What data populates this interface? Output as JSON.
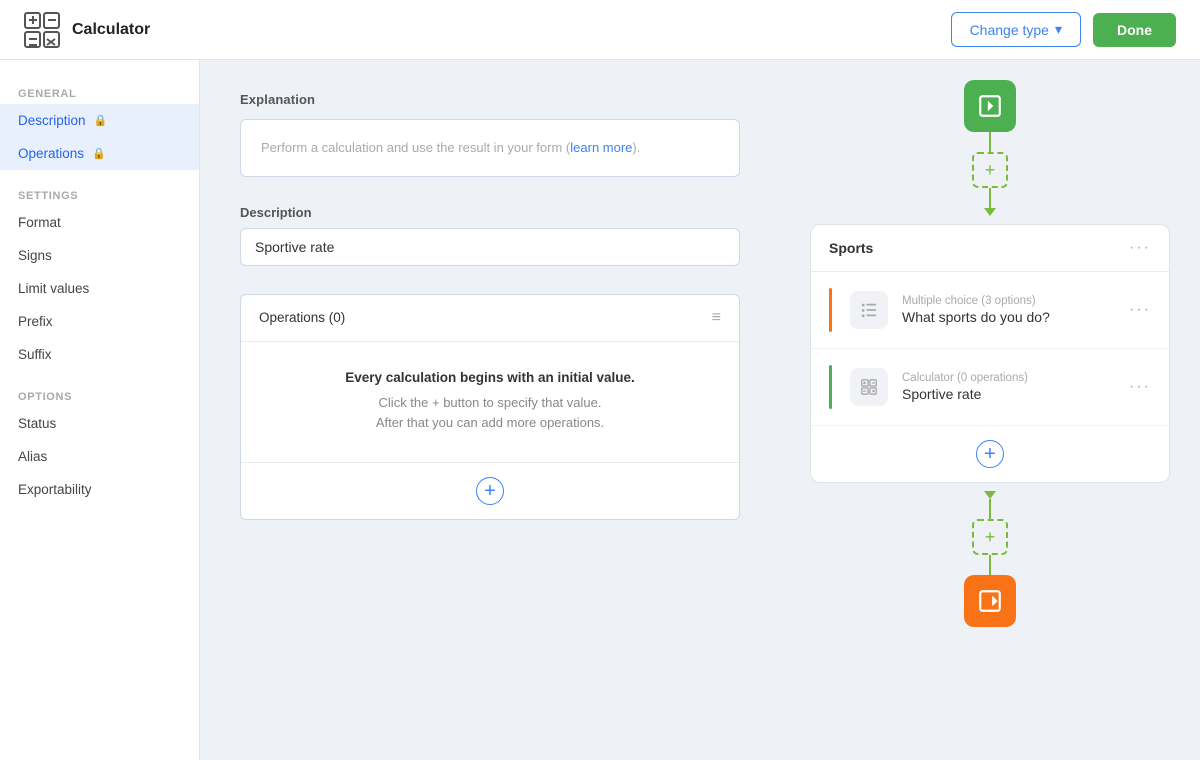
{
  "header": {
    "title": "Calculator",
    "change_type_label": "Change type",
    "done_label": "Done"
  },
  "sidebar": {
    "general_label": "General",
    "settings_label": "Settings",
    "options_label": "Options",
    "items_general": [
      {
        "label": "Description",
        "locked": true,
        "active": true,
        "id": "description"
      },
      {
        "label": "Operations",
        "locked": true,
        "active": true,
        "id": "operations"
      }
    ],
    "items_settings": [
      {
        "label": "Format",
        "locked": false,
        "active": false,
        "id": "format"
      },
      {
        "label": "Signs",
        "locked": false,
        "active": false,
        "id": "signs"
      },
      {
        "label": "Limit values",
        "locked": false,
        "active": false,
        "id": "limit-values"
      },
      {
        "label": "Prefix",
        "locked": false,
        "active": false,
        "id": "prefix"
      },
      {
        "label": "Suffix",
        "locked": false,
        "active": false,
        "id": "suffix"
      }
    ],
    "items_options": [
      {
        "label": "Status",
        "locked": false,
        "active": false,
        "id": "status"
      },
      {
        "label": "Alias",
        "locked": false,
        "active": false,
        "id": "alias"
      },
      {
        "label": "Exportability",
        "locked": false,
        "active": false,
        "id": "exportability"
      }
    ]
  },
  "main": {
    "explanation_title": "Explanation",
    "explanation_text": "Perform a calculation and use the result in your form (",
    "explanation_link": "learn more",
    "explanation_suffix": ").",
    "description_label": "Description",
    "description_value": "Sportive rate",
    "operations_title": "Operations (0)",
    "operations_body_title": "Every calculation begins with an initial value.",
    "operations_body_line1": "Click the + button to specify that value.",
    "operations_body_line2": "After that you can add more operations."
  },
  "right_panel": {
    "card_title": "Sports",
    "row1_subtitle": "Multiple choice (3 options)",
    "row1_name": "What sports do you do?",
    "row2_subtitle": "Calculator (0 operations)",
    "row2_name": "Sportive rate"
  }
}
